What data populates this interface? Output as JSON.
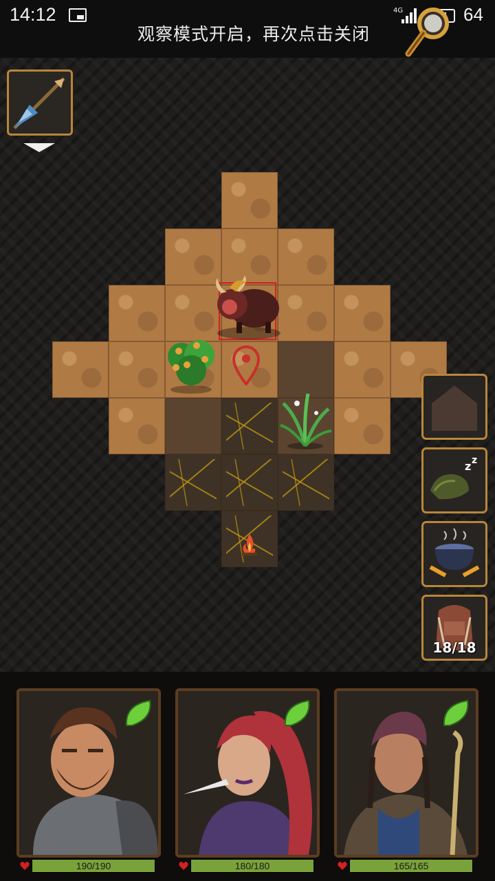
{
  "status_bar": {
    "time": "14:12",
    "network": "4G",
    "battery": "64",
    "notification_icon": "picture-icon",
    "observe_banner": "观察模式开启，再次点击关闭"
  },
  "map": {
    "player_marker_icon": "location-pin-icon",
    "enemy": "bison-beast",
    "campfire_icon": "campfire-icon"
  },
  "weapon_slot": {
    "icon": "spear-icon"
  },
  "side_buttons": [
    {
      "name": "build-button",
      "icon": "hut-icon"
    },
    {
      "name": "sleep-button",
      "icon": "sleeping-bag-icon"
    },
    {
      "name": "cook-button",
      "icon": "cooking-pot-icon"
    },
    {
      "name": "backpack-button",
      "icon": "backpack-icon",
      "count": "18/18"
    }
  ],
  "party": [
    {
      "name": "warrior",
      "hp": "190/190",
      "hp_fraction": 1.0
    },
    {
      "name": "rogue",
      "hp": "180/180",
      "hp_fraction": 1.0
    },
    {
      "name": "shaman",
      "hp": "165/165",
      "hp_fraction": 1.0
    }
  ],
  "colors": {
    "frame_gold": "#b8863a",
    "hp_green": "#7aa23a",
    "enemy_highlight": "#d32020",
    "sand": "#b07a45"
  }
}
